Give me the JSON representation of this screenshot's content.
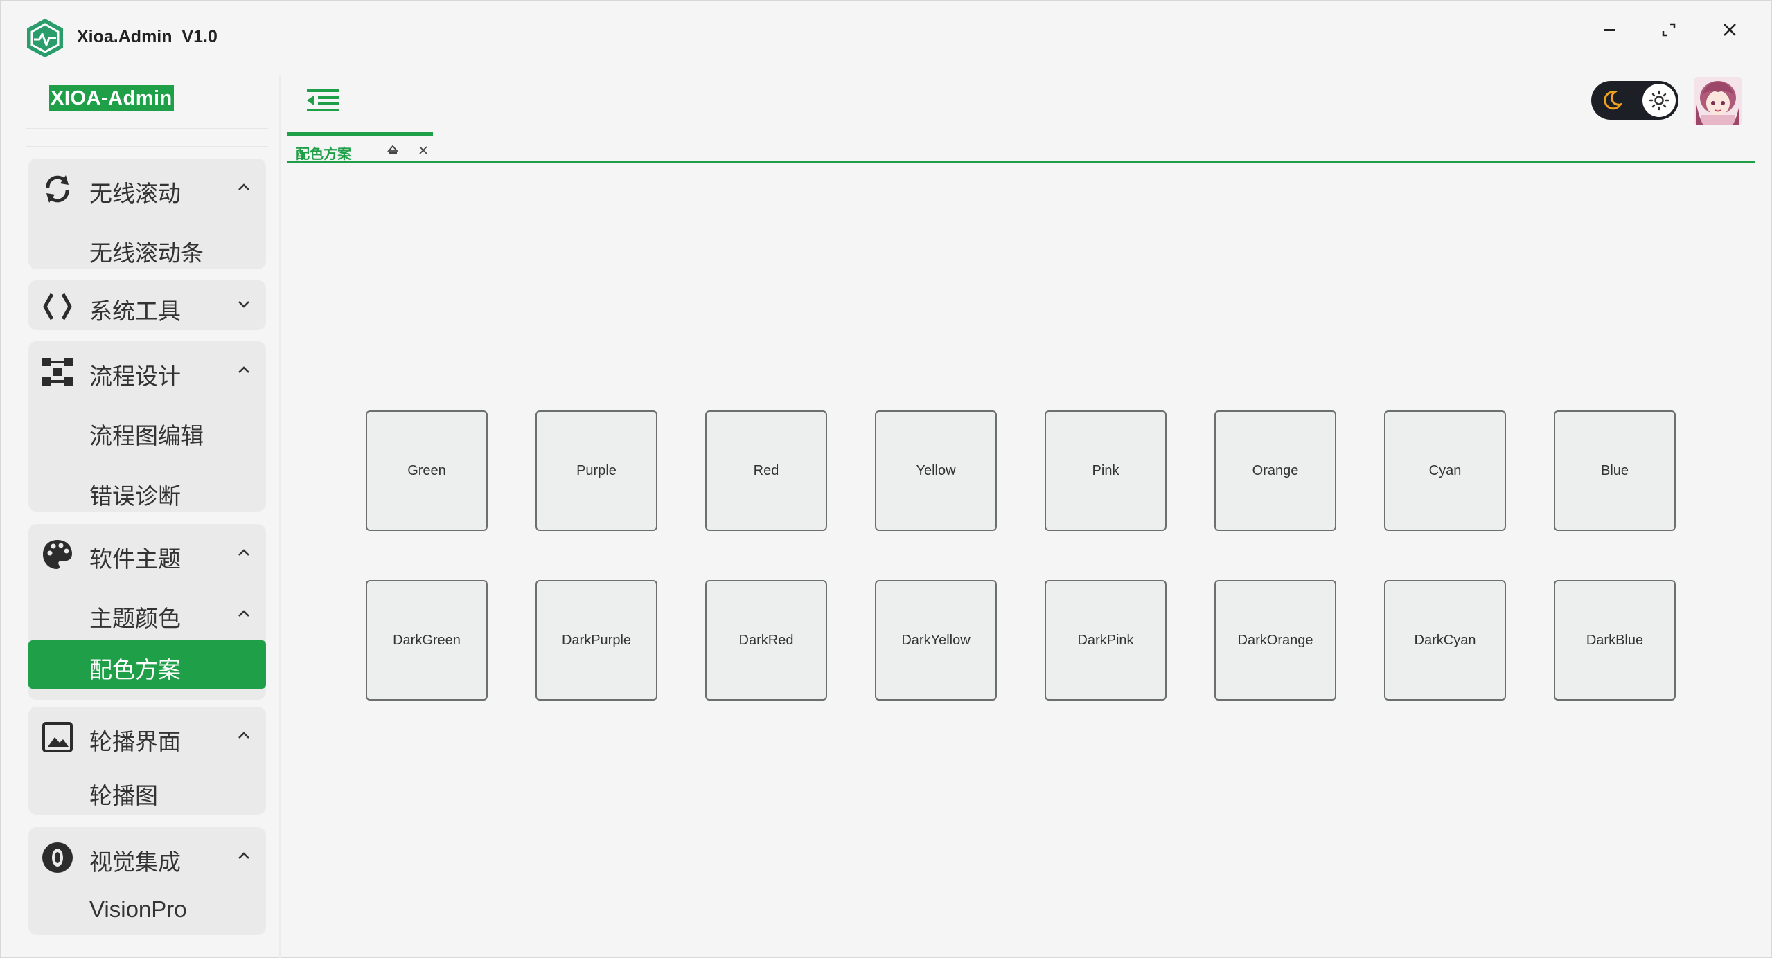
{
  "window": {
    "title": "Xioa.Admin_V1.0",
    "accent": "#1fa048"
  },
  "sidebar": {
    "brand": "XIOA-Admin",
    "groups": [
      {
        "label": "无线滚动",
        "icon": "refresh-icon",
        "expanded": true,
        "items": [
          {
            "label": "无线滚动条"
          }
        ]
      },
      {
        "label": "系统工具",
        "icon": "code-brackets-icon",
        "expanded": false,
        "items": []
      },
      {
        "label": "流程设计",
        "icon": "flow-icon",
        "expanded": true,
        "items": [
          {
            "label": "流程图编辑"
          },
          {
            "label": "错误诊断"
          }
        ]
      },
      {
        "label": "软件主题",
        "icon": "palette-icon",
        "expanded": true,
        "items": [
          {
            "label": "主题颜色",
            "expanded": true
          },
          {
            "label": "配色方案",
            "active": true
          }
        ]
      },
      {
        "label": "轮播界面",
        "icon": "image-icon",
        "expanded": true,
        "items": [
          {
            "label": "轮播图"
          }
        ]
      },
      {
        "label": "视觉集成",
        "icon": "eye-icon",
        "expanded": true,
        "items": [
          {
            "label": "VisionPro"
          }
        ]
      }
    ]
  },
  "header": {
    "theme_toggle": {
      "mode": "light",
      "icons": [
        "moon-icon",
        "sun-icon"
      ]
    }
  },
  "tabs": [
    {
      "label": "配色方案",
      "active": true
    }
  ],
  "color_schemes": {
    "row1": [
      "Green",
      "Purple",
      "Red",
      "Yellow",
      "Pink",
      "Orange",
      "Cyan",
      "Blue"
    ],
    "row2": [
      "DarkGreen",
      "DarkPurple",
      "DarkRed",
      "DarkYellow",
      "DarkPink",
      "DarkOrange",
      "DarkCyan",
      "DarkBlue"
    ]
  }
}
